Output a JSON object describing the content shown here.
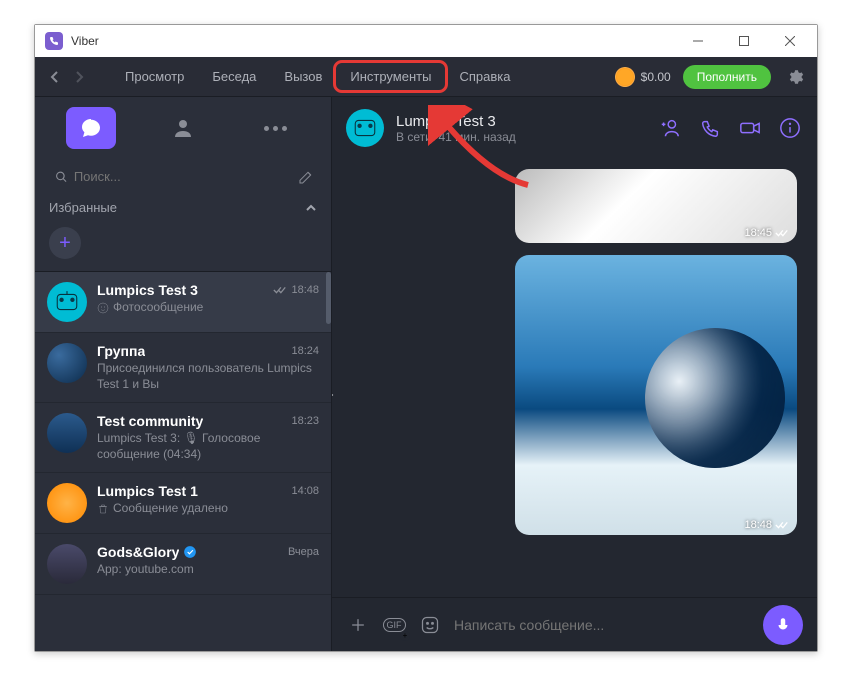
{
  "app_title": "Viber",
  "menu": {
    "view": "Просмотр",
    "chat": "Беседа",
    "call": "Вызов",
    "tools": "Инструменты",
    "help": "Справка"
  },
  "balance": "$0.00",
  "topup": "Пополнить",
  "search_placeholder": "Поиск...",
  "favorites_label": "Избранные",
  "chats": [
    {
      "name": "Lumpics Test 3",
      "sub": "Фотосообщение",
      "time": "18:48",
      "read": true,
      "icon": "emoji"
    },
    {
      "name": "Группа",
      "sub": "Присоединился пользователь Lumpics Test 1 и Вы",
      "time": "18:24"
    },
    {
      "name": "Test community",
      "sub": "Lumpics Test 3: 🎙 Голосовое сообщение (04:34)",
      "time": "18:23"
    },
    {
      "name": "Lumpics Test 1",
      "sub": "Сообщение удалено",
      "time": "14:08",
      "icon": "trash"
    },
    {
      "name": "Gods&Glory",
      "sub": "App: youtube.com",
      "time": "Вчера",
      "verified": true
    }
  ],
  "active_chat": {
    "name": "Lumpics Test 3",
    "status": "В сети: 41 мин. назад"
  },
  "msg_times": {
    "m1": "18:45",
    "m2": "18:48"
  },
  "compose_placeholder": "Написать сообщение...",
  "gif": "GIF"
}
